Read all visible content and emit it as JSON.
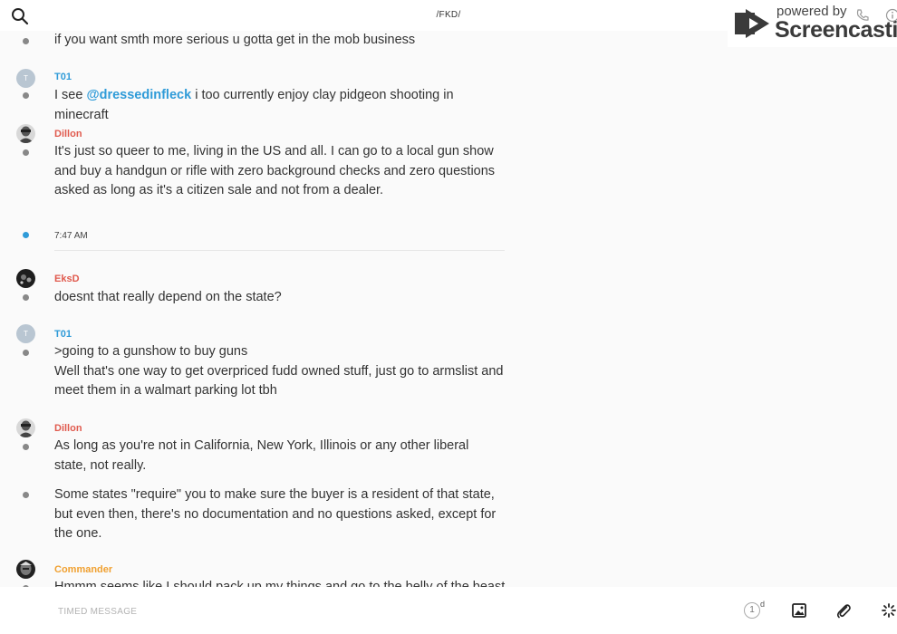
{
  "header": {
    "channel": "/FKD/"
  },
  "watermark": {
    "powered": "powered by",
    "name": "Screencastify"
  },
  "messages": {
    "m0": {
      "text": "if you want smth more serious u gotta get in the mob business"
    },
    "m1": {
      "author": "T01",
      "author_color": "#2f9bd8",
      "avatar_initial": "T",
      "pre": "I see ",
      "mention": "@dressedinfleck",
      "post": " i too currently enjoy clay pidgeon shooting in minecraft"
    },
    "m2": {
      "author": "Dillon",
      "author_color": "#e05a4e",
      "text": "It's just so queer to me, living in the US and all. I can go to a local gun show and buy a handgun or rifle with zero background checks and zero questions asked as long as it's a citizen sale and not from a dealer."
    },
    "separator": {
      "time": "7:47 AM"
    },
    "m3": {
      "author": "EksD",
      "author_color": "#e05a4e",
      "text": "doesnt that really depend on the state?"
    },
    "m4": {
      "author": "T01",
      "author_color": "#2f9bd8",
      "avatar_initial": "T",
      "line1": ">going to a gunshow to buy guns",
      "line2": "Well that's one way to get overpriced fudd owned stuff, just go to armslist and meet them in a walmart parking lot tbh"
    },
    "m5": {
      "author": "Dillon",
      "author_color": "#e05a4e",
      "text": "As long as you're not in California, New York, Illinois or any other liberal state, not really."
    },
    "m6": {
      "text": "Some states \"require\" you to make sure the buyer is a resident of that state, but even then, there's no documentation and no questions asked, except for the one."
    },
    "m7": {
      "author": "Commander",
      "author_color": "#f0a030",
      "text": "Hmmm seems like I should pack up my things and go to the belly of the beast"
    }
  },
  "composer": {
    "placeholder": "TIMED MESSAGE",
    "timer_value": "1",
    "timer_unit": "d"
  },
  "icons": [
    "search-icon",
    "image-icon",
    "paperclip-icon",
    "loading-spinner-icon",
    "phone-icon",
    "info-icon"
  ]
}
